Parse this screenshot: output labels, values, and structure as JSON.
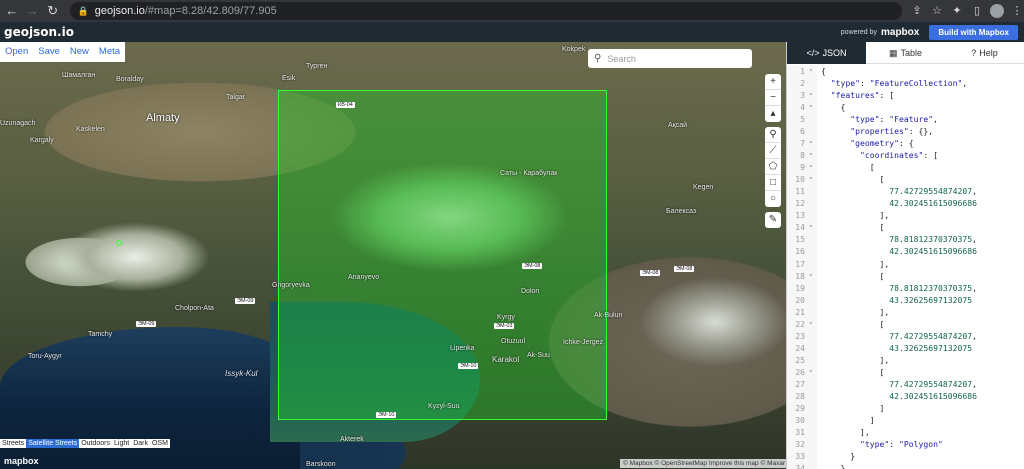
{
  "browser": {
    "url_host": "geojson.io",
    "url_path": "/#map=8.28/42.809/77.905"
  },
  "header": {
    "logo": "geojson.io",
    "powered_by": "powered by",
    "mapbox": "mapbox",
    "build_button": "Build with Mapbox"
  },
  "menu": {
    "open": "Open",
    "save": "Save",
    "new": "New",
    "meta": "Meta"
  },
  "search": {
    "placeholder": "Search"
  },
  "map_styles": {
    "streets": "Streets",
    "satellite": "Satellite Streets",
    "outdoors": "Outdoors",
    "light": "Light",
    "dark": "Dark",
    "osm": "OSM"
  },
  "map_labels": {
    "almaty": "Almaty",
    "issyk_kul": "Issyk-Kul",
    "karakol": "Karakol",
    "kaskelen": "Kaskelen",
    "kargaly": "Kargaly",
    "uzunagach": "Uzunagach",
    "boralday": "Boralday",
    "talgar": "Talgar",
    "esik": "Esik",
    "turgen": "Турген",
    "sati": "Саты - Карабулак",
    "kegen": "Kegen",
    "ananyevo": "Ananyevo",
    "grigoryevka": "Grigoryevka",
    "cholpon_ata": "Cholpon-Ata",
    "tamchy": "Tamchy",
    "toru_aygyr": "Toru-Aygyr",
    "kyrgy": "Kyrgy",
    "otuzuul": "Otuzuul",
    "ichke_jergez": "Ichke-Jergez",
    "ak_bulun": "Ak-Bulun",
    "lipenka": "Lipenka",
    "ak_suu": "Ak-Suu",
    "kyzyl_suu": "Kyzyl-Suu",
    "akterek": "Akterek",
    "barskoon": "Barskoon",
    "kokpek": "Kokpek",
    "shamalgan": "Шамалган",
    "dolon": "Dolon",
    "balkash": "Балексаз",
    "akshiy": "Ақсай"
  },
  "attribution": "© Mapbox © OpenStreetMap Improve this map © Maxar",
  "panel": {
    "tabs": [
      {
        "icon": "</>",
        "label": "JSON"
      },
      {
        "icon": "▦",
        "label": "Table"
      },
      {
        "icon": "?",
        "label": "Help"
      }
    ]
  },
  "code_lines": [
    "{",
    "  \"type\": \"FeatureCollection\",",
    "  \"features\": [",
    "    {",
    "      \"type\": \"Feature\",",
    "      \"properties\": {},",
    "      \"geometry\": {",
    "        \"coordinates\": [",
    "          [",
    "            [",
    "              77.42729554874207,",
    "              42.302451615096686",
    "            ],",
    "            [",
    "              78.81812370370375,",
    "              42.302451615096686",
    "            ],",
    "            [",
    "              78.81812370370375,",
    "              43.32625697132075",
    "            ],",
    "            [",
    "              77.42729554874207,",
    "              43.32625697132075",
    "            ],",
    "            [",
    "              77.42729554874207,",
    "              42.302451615096686",
    "            ]",
    "          ]",
    "        ],",
    "        \"type\": \"Polygon\"",
    "      }",
    "    }"
  ],
  "fold_lines": [
    1,
    3,
    4,
    7,
    8,
    9,
    10,
    14,
    18,
    22,
    26
  ]
}
